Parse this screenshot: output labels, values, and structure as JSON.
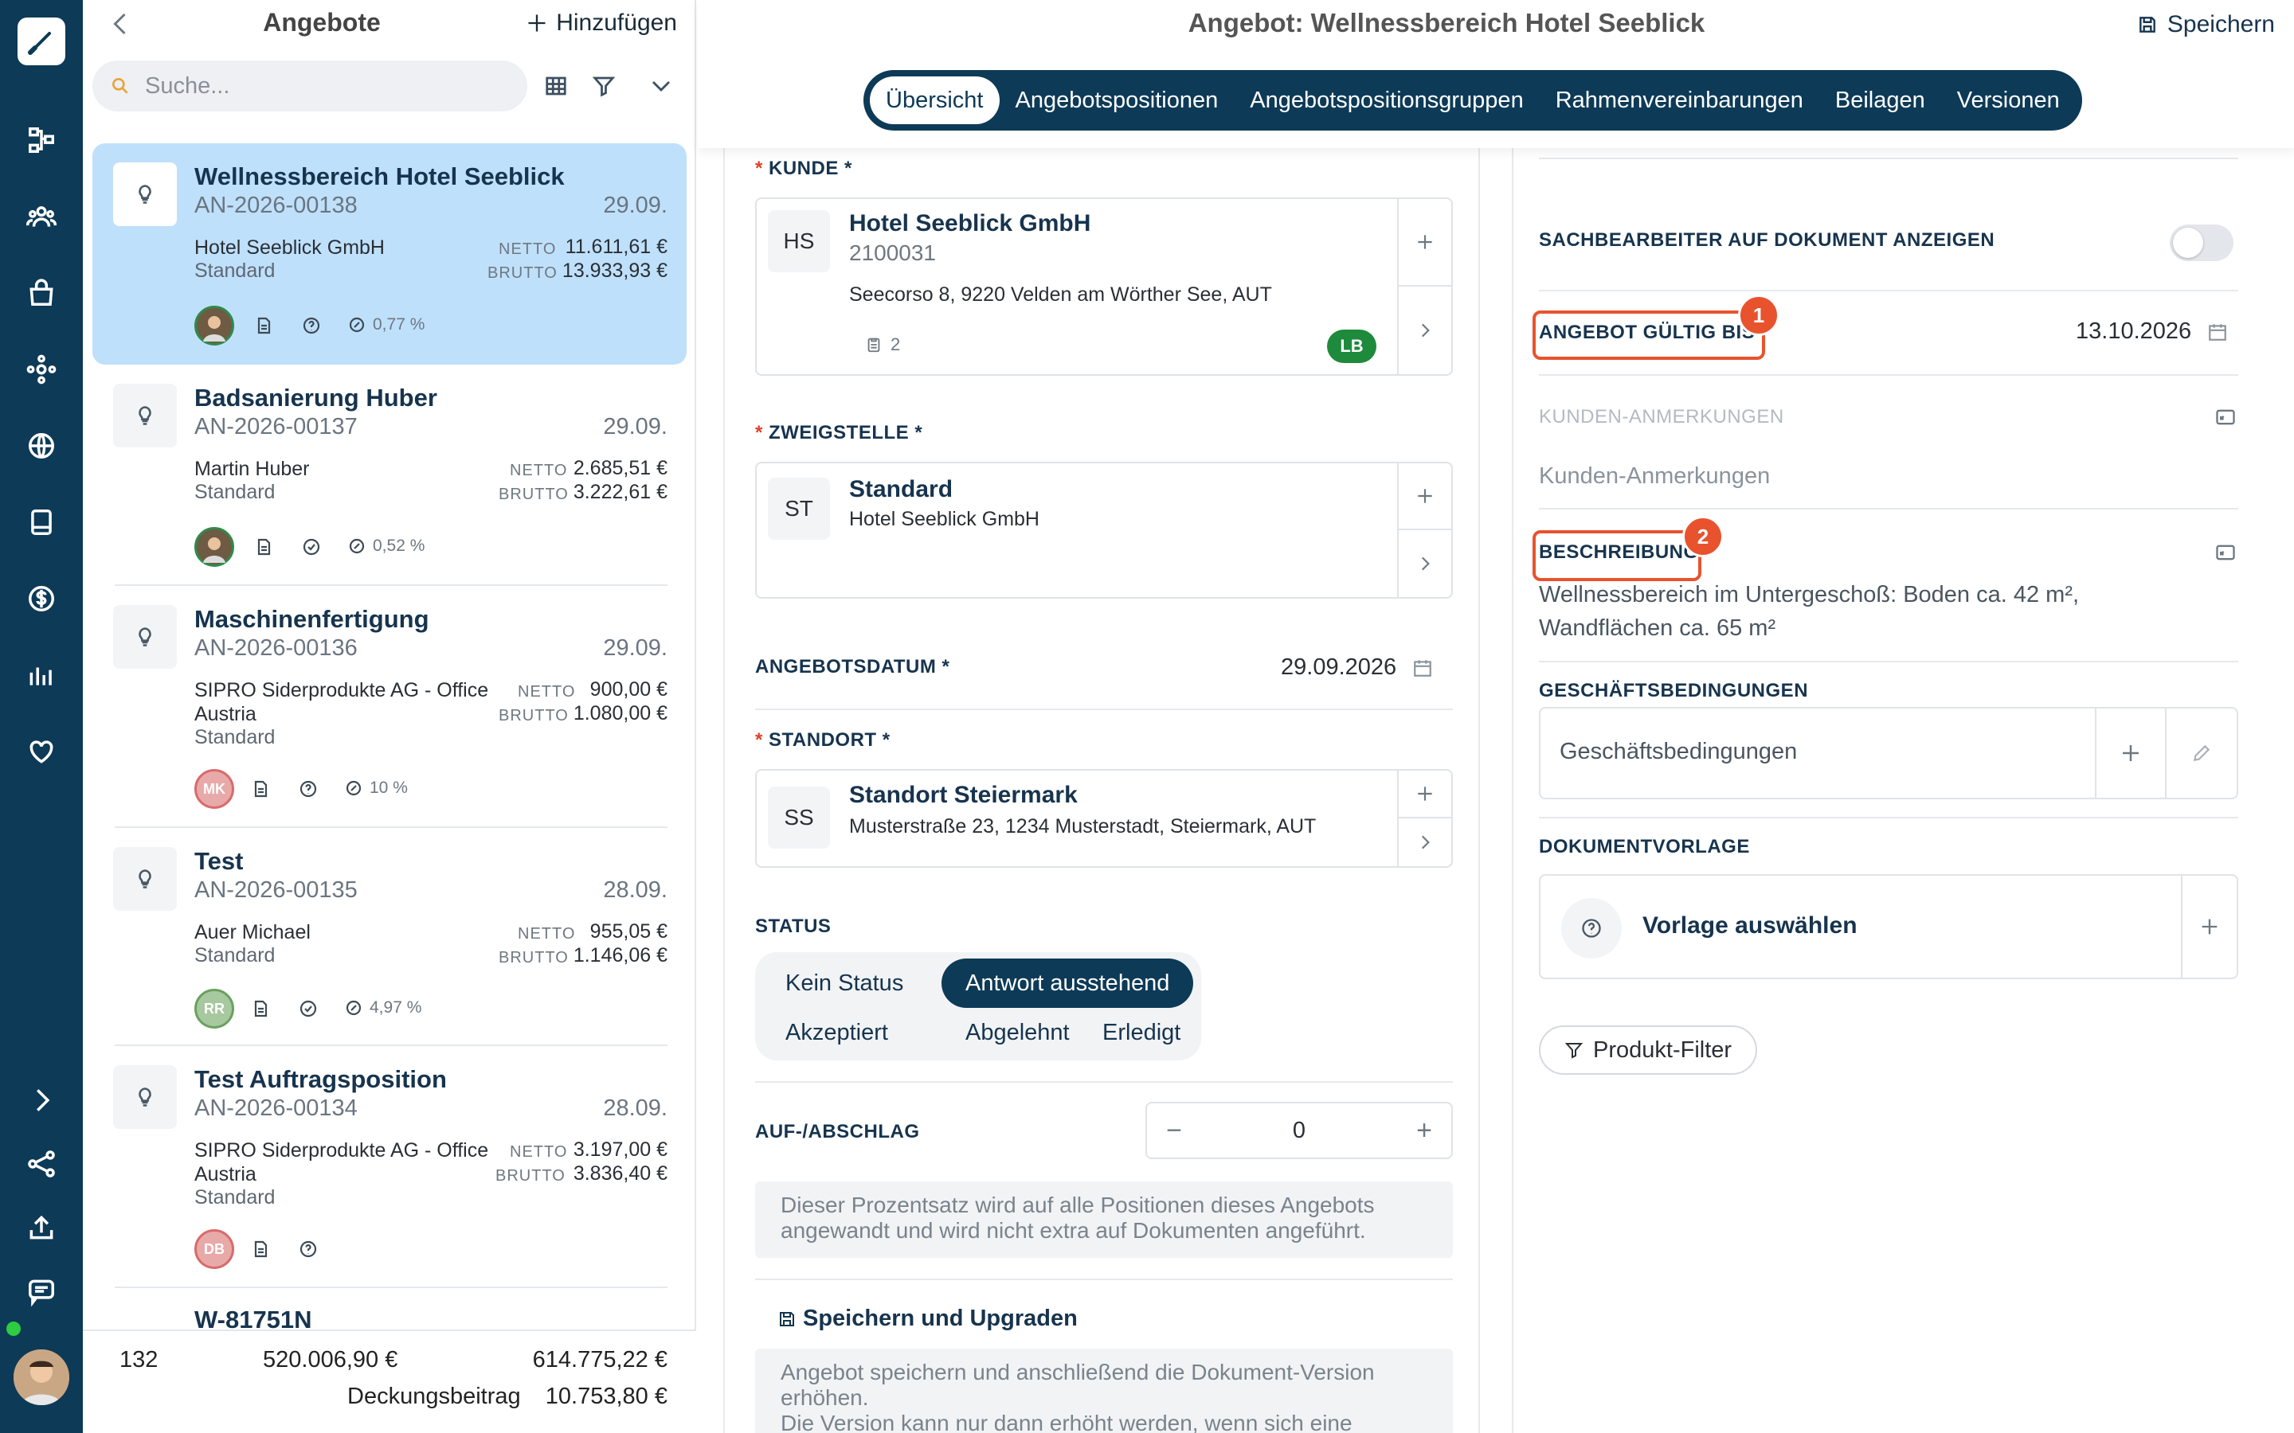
{
  "rail": {
    "icons": [
      "brush-logo-icon",
      "workflow-icon",
      "users-icon",
      "bag-icon",
      "network-icon",
      "globe-icon",
      "document-icon",
      "dollar-icon",
      "chart-icon",
      "heart-icon",
      "chevron-right-icon",
      "share-icon",
      "upload-icon",
      "chat-icon"
    ]
  },
  "list": {
    "title": "Angebote",
    "add_label": "Hinzufügen",
    "search_placeholder": "Suche...",
    "netto_label": "NETTO",
    "brutto_label": "BRUTTO",
    "items": [
      {
        "title": "Wellnessbereich Hotel Seeblick",
        "number": "AN-2026-00138",
        "date": "29.09.",
        "customer": "Hotel Seeblick GmbH",
        "branch": "Standard",
        "netto": "11.611,61 €",
        "brutto": "13.933,93 €",
        "percent": "0,77 %",
        "avatar": "",
        "status_icon": "question-circle-icon"
      },
      {
        "title": "Badsanierung Huber",
        "number": "AN-2026-00137",
        "date": "29.09.",
        "customer": "Martin Huber",
        "branch": "Standard",
        "netto": "2.685,51 €",
        "brutto": "3.222,61 €",
        "percent": "0,52 %",
        "avatar": "",
        "status_icon": "check-circle-icon"
      },
      {
        "title": "Maschinenfertigung",
        "number": "AN-2026-00136",
        "date": "29.09.",
        "customer": "SIPRO Siderprodukte AG - Office Austria",
        "branch": "Standard",
        "netto": "900,00 €",
        "brutto": "1.080,00 €",
        "percent": "10 %",
        "avatar": "MK",
        "status_icon": "question-circle-icon"
      },
      {
        "title": "Test",
        "number": "AN-2026-00135",
        "date": "28.09.",
        "customer": "Auer Michael",
        "branch": "Standard",
        "netto": "955,05 €",
        "brutto": "1.146,06 €",
        "percent": "4,97 %",
        "avatar": "RR",
        "status_icon": "check-circle-icon"
      },
      {
        "title": "Test Auftragsposition",
        "number": "AN-2026-00134",
        "date": "28.09.",
        "customer": "SIPRO Siderprodukte AG - Office Austria",
        "branch": "Standard",
        "netto": "3.197,00 €",
        "brutto": "3.836,40 €",
        "percent": "",
        "avatar": "DB",
        "status_icon": "question-circle-icon"
      },
      {
        "title": "W-81751N"
      }
    ],
    "footer": {
      "count": "132",
      "netto_total": "520.006,90 €",
      "brutto_total": "614.775,22 €",
      "db_label": "Deckungsbeitrag",
      "db_value": "10.753,80 €"
    }
  },
  "header": {
    "title": "Angebot: Wellnessbereich Hotel Seeblick",
    "save_label": "Speichern",
    "tabs": [
      "Übersicht",
      "Angebotspositionen",
      "Angebotspositionsgruppen",
      "Rahmenvereinbarungen",
      "Beilagen",
      "Versionen"
    ]
  },
  "form": {
    "kunde": {
      "label": "KUNDE",
      "initials": "HS",
      "name": "Hotel Seeblick GmbH",
      "number": "2100031",
      "address": "Seecorso 8, 9220 Velden am Wörther See, AUT",
      "doc_count": "2",
      "badge": "LB"
    },
    "zweigstelle": {
      "label": "ZWEIGSTELLE",
      "initials": "ST",
      "name": "Standard",
      "sub": "Hotel Seeblick GmbH"
    },
    "angebotsdatum": {
      "label": "ANGEBOTSDATUM *",
      "value": "29.09.2026"
    },
    "standort": {
      "label": "STANDORT",
      "initials": "SS",
      "name": "Standort Steiermark",
      "address": "Musterstraße 23, 1234 Musterstadt, Steiermark, AUT"
    },
    "status": {
      "label": "STATUS",
      "options": [
        "Kein Status",
        "Antwort ausstehend",
        "Akzeptiert",
        "Abgelehnt",
        "Erledigt"
      ],
      "selected": "Antwort ausstehend"
    },
    "aufschlag": {
      "label": "AUF-/ABSCHLAG",
      "value": "0",
      "info": "Dieser Prozentsatz wird auf alle Positionen dieses Angebots angewandt und wird nicht extra auf Dokumenten angeführt."
    },
    "upgrade": {
      "label": "Speichern und Upgraden",
      "info_line1": "Angebot speichern und anschließend die Dokument-Version erhöhen.",
      "info_line2": "Die Version kann nur dann erhöht werden, wenn sich eine"
    }
  },
  "right": {
    "sachbearbeiter_label": "SACHBEARBEITER AUF DOKUMENT ANZEIGEN",
    "sachbearbeiter_on": false,
    "gueltig_label": "ANGEBOT GÜLTIG BIS",
    "gueltig_value": "13.10.2026",
    "marker1": "1",
    "kunden_anm_label": "KUNDEN-ANMERKUNGEN",
    "kunden_anm_placeholder": "Kunden-Anmerkungen",
    "beschreibung_label": "BESCHREIBUNG",
    "marker2": "2",
    "beschreibung_text": "Wellnessbereich im Untergeschoß: Boden ca. 42 m², Wandflächen ca. 65 m²",
    "gb_label": "GESCHÄFTSBEDINGUNGEN",
    "gb_placeholder": "Geschäftsbedingungen",
    "dv_label": "DOKUMENTVORLAGE",
    "dv_placeholder": "Vorlage auswählen",
    "filter_label": "Produkt-Filter",
    "accent_color": "#e8532e"
  }
}
